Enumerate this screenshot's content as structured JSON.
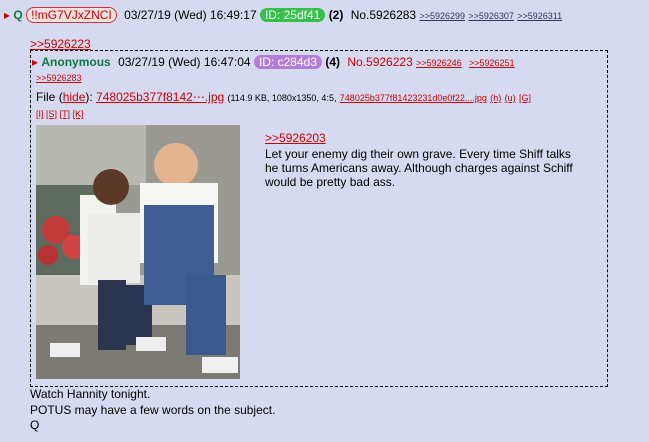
{
  "main_post": {
    "expand_arrow": "▸",
    "name": "Q",
    "tripcode": "!!mG7VJxZNCI",
    "datetime": "03/27/19 (Wed) 16:49:17",
    "id_label": "ID: 25df41",
    "post_count": "(2)",
    "post_no": "No.5926283",
    "backlinks": [
      ">>5926299",
      ">>5926307",
      ">>5926311"
    ],
    "quote_link": ">>5926223",
    "message_lines": [
      "Watch Hannity tonight.",
      "POTUS may have a few words on the subject.",
      "Q"
    ]
  },
  "quoted_post": {
    "expand_arrow": "▸",
    "name": "Anonymous",
    "datetime": "03/27/19 (Wed) 16:47:04",
    "id_label": "ID: c284d3",
    "post_count": "(4)",
    "post_no": "No.5926223",
    "backlinks": [
      ">>5926246",
      ">>5926251",
      ">>5926283"
    ],
    "file": {
      "label": "File",
      "hide_open": "(",
      "hide": "hide",
      "hide_close": "):",
      "name": "748025b377f8142⋯.jpg",
      "meta": "(114.9 KB, 1080x1350, 4:5,",
      "full_name": "748025b377f81423231d0e0f22....jpg",
      "actions_inline": [
        "(h)",
        "(u)",
        "[G]"
      ],
      "actions_row": [
        "[I]",
        "[S]",
        "[T]",
        "[K]"
      ]
    },
    "quote_link": ">>5926203",
    "message": "Let your enemy dig their own grave. Every time Shiff talks he turns Americans away. Although charges against Schiff would be pretty bad ass."
  },
  "colors": {
    "background": "#d6daf0",
    "link_red": "#cc0000",
    "name_green": "#117743",
    "id_green": "#34c04a",
    "id_purple": "#b47cd6"
  }
}
